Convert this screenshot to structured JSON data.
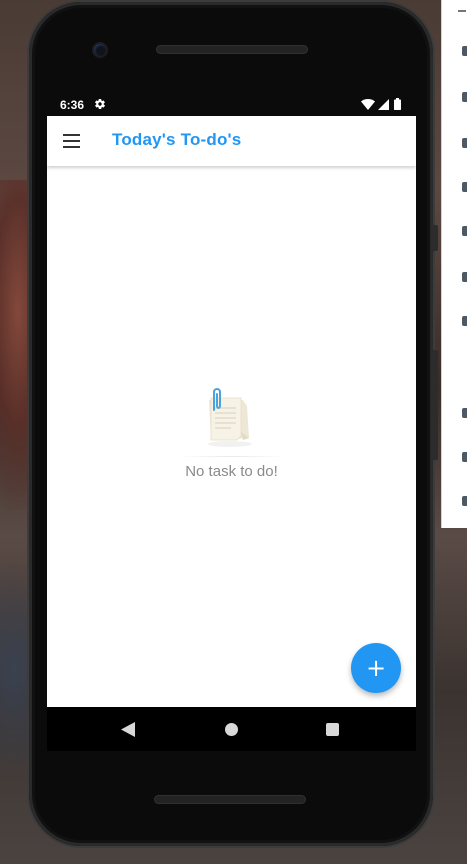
{
  "status_bar": {
    "time": "6:36",
    "icons": [
      "gear-icon",
      "wifi-icon",
      "signal-icon",
      "battery-icon"
    ]
  },
  "app_bar": {
    "title": "Today's To-do's",
    "menu_icon": "menu-icon"
  },
  "empty_state": {
    "icon": "notes-icon",
    "message": "No task to do!"
  },
  "fab": {
    "label": "+",
    "icon": "add-icon"
  },
  "nav_bar": {
    "buttons": [
      "back",
      "home",
      "recents"
    ]
  },
  "colors": {
    "accent": "#2196f3",
    "screen_bg": "#ffffff",
    "empty_text": "#8a8a8a",
    "phone_body": "#0b0b0b"
  }
}
